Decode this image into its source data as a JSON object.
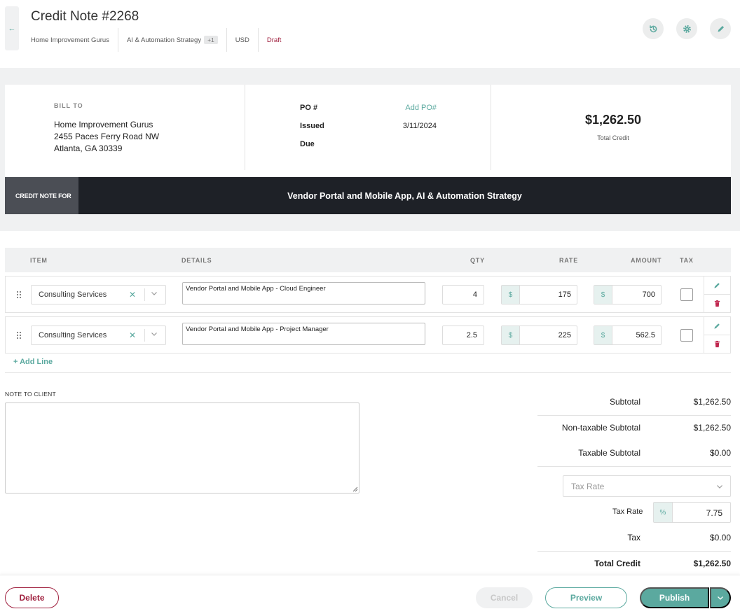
{
  "header": {
    "title": "Credit Note #2268",
    "client": "Home Improvement Gurus",
    "project": "AI & Automation Strategy",
    "project_extra": "+1",
    "currency": "USD",
    "status": "Draft",
    "icons": [
      "back-arrow-icon",
      "history-icon",
      "gear-icon",
      "pencil-icon"
    ],
    "status_color": "#a0213f"
  },
  "bill_to": {
    "label": "BILL TO",
    "name": "Home Improvement Gurus",
    "address1": "2455 Paces Ferry Road NW",
    "address2": "Atlanta, GA 30339"
  },
  "meta": {
    "po_label": "PO #",
    "po_value": "Add PO#",
    "issued_label": "Issued",
    "issued_value": "3/11/2024",
    "due_label": "Due",
    "due_value": ""
  },
  "total": {
    "amount": "$1,262.50",
    "label": "Total Credit"
  },
  "credit_note_for": {
    "label": "CREDIT NOTE FOR",
    "value": "Vendor Portal and Mobile App, AI & Automation Strategy"
  },
  "table": {
    "headers": {
      "item": "ITEM",
      "details": "DETAILS",
      "qty": "QTY",
      "rate": "RATE",
      "amount": "AMOUNT",
      "tax": "TAX"
    },
    "currency_symbol": "$",
    "rows": [
      {
        "item": "Consulting Services",
        "details": "Vendor Portal and Mobile App - Cloud Engineer",
        "qty": "4",
        "rate": "175",
        "amount": "700"
      },
      {
        "item": "Consulting Services",
        "details": "Vendor Portal and Mobile App - Project Manager",
        "qty": "2.5",
        "rate": "225",
        "amount": "562.5"
      }
    ],
    "add_line": "+ Add Line"
  },
  "note": {
    "label": "NOTE TO CLIENT",
    "value": ""
  },
  "totals": {
    "subtotal_label": "Subtotal",
    "subtotal": "$1,262.50",
    "nontaxable_label": "Non-taxable Subtotal",
    "nontaxable": "$1,262.50",
    "taxable_label": "Taxable Subtotal",
    "taxable": "$0.00",
    "tax_rate_placeholder": "Tax Rate",
    "tax_rate_label": "Tax Rate",
    "percent_symbol": "%",
    "tax_rate_value": "7.75",
    "tax_label": "Tax",
    "tax": "$0.00",
    "total_label": "Total Credit",
    "total": "$1,262.50"
  },
  "footer": {
    "delete": "Delete",
    "cancel": "Cancel",
    "preview": "Preview",
    "publish": "Publish"
  },
  "colors": {
    "accent": "#5ba99f",
    "danger": "#a0213f",
    "dark_bar": "#1e2127"
  }
}
